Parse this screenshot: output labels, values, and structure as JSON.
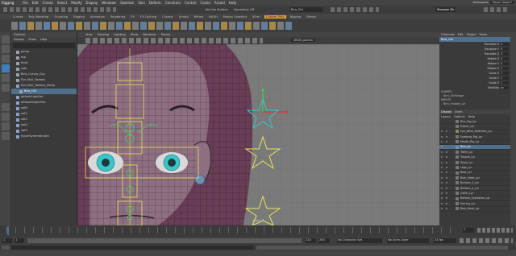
{
  "menubar": {
    "mode": "Rigging",
    "items": [
      "File",
      "Edit",
      "Create",
      "Select",
      "Modify",
      "Display",
      "Windows",
      "Skeleton",
      "Skin",
      "Deform",
      "Constrain",
      "Control",
      "Cache",
      "Arnold",
      "Help"
    ],
    "workspace_label": "Workspace:",
    "workspace_value": "Maya Classic*"
  },
  "statusline": {
    "field1": "Bira_Ctrl",
    "field2": "No Live Surface",
    "field3": "Symmetry: Off",
    "field4": "Shannon Pic"
  },
  "shelf_tabs": [
    "Curves",
    "Poly Modeling",
    "Sculpting",
    "Rigging",
    "Animation",
    "Rendering",
    "FX",
    "FX Caching",
    "Custom",
    "Arnold",
    "Bifrost",
    "MASH",
    "Motion Graphics",
    "XGen",
    "Custom_Poly",
    "Rigging",
    "Bifrost"
  ],
  "shelf_active": "Custom_Poly",
  "outliner": {
    "title": "Outliner",
    "menu": [
      "Display",
      "Show",
      "Help"
    ],
    "rows": [
      {
        "label": "persp",
        "indent": 1,
        "selected": false
      },
      {
        "label": "top",
        "indent": 1,
        "selected": false
      },
      {
        "label": "front",
        "indent": 1,
        "selected": false
      },
      {
        "label": "side",
        "indent": 1,
        "selected": false
      },
      {
        "label": "Bira_Curves_Grp",
        "indent": 1,
        "selected": false
      },
      {
        "label": "Eye_Null_Tweaks",
        "indent": 1,
        "selected": false
      },
      {
        "label": "Eye_Null_Tweaks_Setup",
        "indent": 1,
        "selected": false
      },
      {
        "label": "Bira_Ctrl",
        "indent": 2,
        "selected": true
      },
      {
        "label": "defaultLightSet",
        "indent": 1,
        "selected": false
      },
      {
        "label": "defaultObjectSet",
        "indent": 1,
        "selected": false
      },
      {
        "label": "set6",
        "indent": 1,
        "selected": false
      },
      {
        "label": "set2",
        "indent": 1,
        "selected": false
      },
      {
        "label": "set3",
        "indent": 1,
        "selected": false
      },
      {
        "label": "set4",
        "indent": 1,
        "selected": false
      },
      {
        "label": "set5",
        "indent": 1,
        "selected": false
      },
      {
        "label": "hyperSymmetrySet",
        "indent": 1,
        "selected": false
      }
    ]
  },
  "viewport": {
    "menu": [
      "View",
      "Shading",
      "Lighting",
      "Show",
      "Renderer",
      "Panels"
    ],
    "colorspace": "sRGB gamma",
    "camera_label": "front -Z"
  },
  "channel_box": {
    "menu": [
      "Channels",
      "Edit",
      "Object",
      "Show"
    ],
    "object": "Bira_Ctrl",
    "attributes": [
      {
        "name": "Translate X",
        "value": "0"
      },
      {
        "name": "Translate Y",
        "value": "0"
      },
      {
        "name": "Translate Z",
        "value": "0"
      },
      {
        "name": "Rotate X",
        "value": "0"
      },
      {
        "name": "Rotate Y",
        "value": "0"
      },
      {
        "name": "Rotate Z",
        "value": "0"
      },
      {
        "name": "Scale X",
        "value": "1"
      },
      {
        "name": "Scale Y",
        "value": "1"
      },
      {
        "name": "Scale Z",
        "value": "1"
      },
      {
        "name": "Visibility",
        "value": "on"
      }
    ],
    "shapes_label": "SHAPES",
    "shape": "Bira_CtrlShape",
    "inputs_label": "INPUTS",
    "input": "Bira_Shapes_Lyr"
  },
  "layers": {
    "tabs": [
      "Display",
      "Anim"
    ],
    "menu": [
      "Layers",
      "Options",
      "Help"
    ],
    "rows": [
      {
        "v": "",
        "p": "",
        "label": "Bira_Rig_Lyr",
        "color": "#777777",
        "selected": false
      },
      {
        "v": "",
        "p": "",
        "label": "Export_Lyr",
        "color": "#777777",
        "selected": false
      },
      {
        "v": "V",
        "p": "P",
        "label": "Eye_Blink_Selection_Lyr",
        "color": "#8a8a5a",
        "selected": false
      },
      {
        "v": "V",
        "p": "P",
        "label": "Eyebrow_Rig_Lyr",
        "color": "#777777",
        "selected": false
      },
      {
        "v": "V",
        "p": "P",
        "label": "Mouth_Rig_Lyr",
        "color": "#777777",
        "selected": false
      },
      {
        "v": "V",
        "p": "",
        "label": "Bira_Lyr",
        "color": "#6a8fb0",
        "selected": true
      },
      {
        "v": "V",
        "p": "P",
        "label": "Teeth_Lyr",
        "color": "#777777",
        "selected": false
      },
      {
        "v": "V",
        "p": "P",
        "label": "Tongue_Lyr",
        "color": "#777777",
        "selected": false
      },
      {
        "v": "V",
        "p": "P",
        "label": "Torso_Lyr",
        "color": "#777777",
        "selected": false
      },
      {
        "v": "V",
        "p": "P",
        "label": "Legs_Lyr",
        "color": "#777777",
        "selected": false
      },
      {
        "v": "V",
        "p": "P",
        "label": "Boot_Lyr",
        "color": "#777777",
        "selected": false
      },
      {
        "v": "V",
        "p": "P",
        "label": "Bow_Sides_Lyr",
        "color": "#777777",
        "selected": false
      },
      {
        "v": "V",
        "p": "P",
        "label": "Buttons_1_Lyr",
        "color": "#777777",
        "selected": false
      },
      {
        "v": "V",
        "p": "P",
        "label": "Buttons_2_Lyr",
        "color": "#777777",
        "selected": false
      },
      {
        "v": "V",
        "p": "P",
        "label": "Collar_Lyr",
        "color": "#777777",
        "selected": false
      },
      {
        "v": "V",
        "p": "P",
        "label": "Bottom_Eyelashes_Lyr",
        "color": "#777777",
        "selected": false
      },
      {
        "v": "V",
        "p": "P",
        "label": "Earring_Lyr",
        "color": "#777777",
        "selected": false
      },
      {
        "v": "V",
        "p": "P",
        "label": "Bow_Head_Lyr",
        "color": "#777777",
        "selected": false
      }
    ]
  },
  "timeline": {
    "start": "1",
    "end": "120",
    "range_end": "200",
    "current": "1",
    "character_set": "No Character Set",
    "anim_layer": "No Anim Layer",
    "fps": "24 fps"
  },
  "colors": {
    "accent": "#e6a43b",
    "selection": "#4f6f8d",
    "skin": "#8e6f82",
    "hair": "#6a3d57",
    "wire": "#2a1d26",
    "control": "#e4e65a",
    "iris": "#38c6c9"
  }
}
